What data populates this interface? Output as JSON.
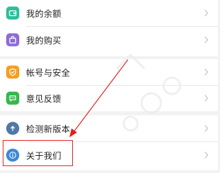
{
  "menu": {
    "items": [
      {
        "label": "我的余额",
        "icon": "wallet-icon",
        "color": "#2bbf9b"
      },
      {
        "label": "我的购买",
        "icon": "shopping-bag-icon",
        "color": "#8e6bd6"
      },
      {
        "label": "帐号与安全",
        "icon": "shield-check-icon",
        "color": "#f2a023"
      },
      {
        "label": "意见反馈",
        "icon": "chat-bubble-icon",
        "color": "#36b84c"
      },
      {
        "label": "检测新版本",
        "icon": "upload-arrow-icon",
        "color": "#4f78a8"
      },
      {
        "label": "关于我们",
        "icon": "info-icon",
        "color": "#3b88d9"
      }
    ]
  },
  "annotation": {
    "highlight_color": "#e02020",
    "target": "关于我们"
  }
}
